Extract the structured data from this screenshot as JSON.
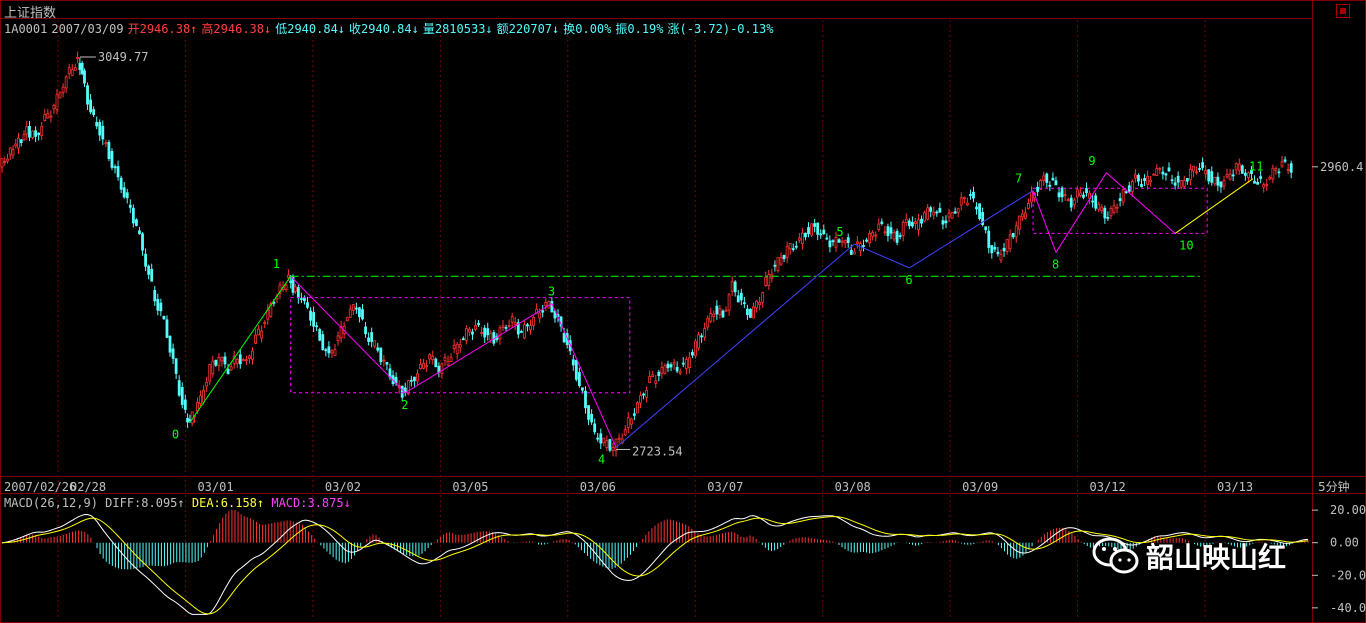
{
  "header": {
    "title": "上证指数",
    "code": "1A0001",
    "date": "2007/03/09",
    "open": "开2946.38↑",
    "high": "高2946.38↓",
    "low": "低2940.84↓",
    "close": "收2940.84↓",
    "volume": "量2810533↓",
    "amount": "额220707↓",
    "turnover": "换0.00%",
    "amplitude": "振0.19%",
    "change": "涨(-3.72)-0.13%"
  },
  "macd_header": {
    "label": "MACD(26,12,9)",
    "diff": "DIFF:8.095↑",
    "dea": "DEA:6.158↑",
    "macd": "MACD:3.875↓"
  },
  "period_label": "5分钟",
  "watermark": "韶山映山红",
  "colors": {
    "up": "#ff3232",
    "down": "#54fcfc",
    "grid": "#800000",
    "fib_line": "#ff00ff",
    "green": "#00ff00",
    "blue": "#4040ff",
    "yellow": "#ffff00"
  },
  "chart_data": {
    "type": "line",
    "x_labels": [
      "2007/02/26",
      "02/28",
      "03/01",
      "03/02",
      "03/05",
      "03/06",
      "03/07",
      "03/08",
      "03/09",
      "03/12",
      "03/13"
    ],
    "price_labels": {
      "high": "3049.77",
      "low": "2723.54",
      "last": "2960.4"
    },
    "ylim": [
      2700,
      3070
    ],
    "price_path": [
      [
        0,
        2960
      ],
      [
        3,
        2975
      ],
      [
        6,
        2990
      ],
      [
        8,
        2985
      ],
      [
        10,
        3000
      ],
      [
        12,
        3010
      ],
      [
        14,
        3030
      ],
      [
        16,
        3045
      ],
      [
        17,
        3049
      ],
      [
        18,
        3040
      ],
      [
        20,
        3005
      ],
      [
        22,
        2990
      ],
      [
        24,
        2970
      ],
      [
        26,
        2950
      ],
      [
        28,
        2930
      ],
      [
        30,
        2910
      ],
      [
        32,
        2880
      ],
      [
        34,
        2850
      ],
      [
        36,
        2830
      ],
      [
        38,
        2795
      ],
      [
        40,
        2760
      ],
      [
        41,
        2745
      ],
      [
        42,
        2750
      ],
      [
        44,
        2765
      ],
      [
        46,
        2790
      ],
      [
        48,
        2800
      ],
      [
        50,
        2790
      ],
      [
        52,
        2800
      ],
      [
        54,
        2795
      ],
      [
        56,
        2815
      ],
      [
        58,
        2830
      ],
      [
        60,
        2850
      ],
      [
        62,
        2860
      ],
      [
        63,
        2868
      ],
      [
        64,
        2858
      ],
      [
        66,
        2850
      ],
      [
        68,
        2835
      ],
      [
        70,
        2815
      ],
      [
        72,
        2800
      ],
      [
        74,
        2815
      ],
      [
        76,
        2835
      ],
      [
        78,
        2845
      ],
      [
        80,
        2820
      ],
      [
        82,
        2810
      ],
      [
        84,
        2795
      ],
      [
        86,
        2780
      ],
      [
        88,
        2770
      ],
      [
        90,
        2780
      ],
      [
        92,
        2790
      ],
      [
        94,
        2800
      ],
      [
        96,
        2790
      ],
      [
        98,
        2800
      ],
      [
        100,
        2810
      ],
      [
        102,
        2820
      ],
      [
        104,
        2825
      ],
      [
        106,
        2820
      ],
      [
        108,
        2815
      ],
      [
        110,
        2825
      ],
      [
        112,
        2830
      ],
      [
        114,
        2820
      ],
      [
        116,
        2830
      ],
      [
        118,
        2840
      ],
      [
        120,
        2845
      ],
      [
        122,
        2830
      ],
      [
        124,
        2810
      ],
      [
        126,
        2785
      ],
      [
        128,
        2760
      ],
      [
        130,
        2735
      ],
      [
        132,
        2728
      ],
      [
        134,
        2724
      ],
      [
        136,
        2735
      ],
      [
        138,
        2750
      ],
      [
        140,
        2765
      ],
      [
        142,
        2780
      ],
      [
        144,
        2785
      ],
      [
        146,
        2795
      ],
      [
        148,
        2790
      ],
      [
        150,
        2795
      ],
      [
        152,
        2810
      ],
      [
        154,
        2825
      ],
      [
        156,
        2840
      ],
      [
        158,
        2835
      ],
      [
        160,
        2860
      ],
      [
        162,
        2845
      ],
      [
        164,
        2835
      ],
      [
        166,
        2850
      ],
      [
        168,
        2870
      ],
      [
        170,
        2880
      ],
      [
        172,
        2890
      ],
      [
        174,
        2895
      ],
      [
        176,
        2905
      ],
      [
        178,
        2910
      ],
      [
        180,
        2900
      ],
      [
        182,
        2895
      ],
      [
        184,
        2900
      ],
      [
        186,
        2890
      ],
      [
        188,
        2895
      ],
      [
        190,
        2900
      ],
      [
        192,
        2910
      ],
      [
        194,
        2905
      ],
      [
        196,
        2900
      ],
      [
        198,
        2915
      ],
      [
        200,
        2910
      ],
      [
        202,
        2920
      ],
      [
        204,
        2925
      ],
      [
        206,
        2915
      ],
      [
        208,
        2920
      ],
      [
        210,
        2930
      ],
      [
        212,
        2935
      ],
      [
        214,
        2920
      ],
      [
        216,
        2895
      ],
      [
        218,
        2885
      ],
      [
        220,
        2895
      ],
      [
        222,
        2910
      ],
      [
        224,
        2925
      ],
      [
        226,
        2940
      ],
      [
        228,
        2950
      ],
      [
        230,
        2945
      ],
      [
        232,
        2935
      ],
      [
        234,
        2930
      ],
      [
        236,
        2940
      ],
      [
        238,
        2935
      ],
      [
        240,
        2925
      ],
      [
        242,
        2918
      ],
      [
        244,
        2930
      ],
      [
        246,
        2940
      ],
      [
        248,
        2950
      ],
      [
        250,
        2945
      ],
      [
        252,
        2955
      ],
      [
        254,
        2958
      ],
      [
        256,
        2950
      ],
      [
        258,
        2945
      ],
      [
        260,
        2955
      ],
      [
        262,
        2960
      ],
      [
        264,
        2952
      ],
      [
        266,
        2945
      ],
      [
        268,
        2950
      ],
      [
        270,
        2960
      ],
      [
        272,
        2955
      ],
      [
        274,
        2950
      ],
      [
        276,
        2945
      ],
      [
        278,
        2955
      ],
      [
        280,
        2962
      ],
      [
        282,
        2958
      ]
    ],
    "wave_points": [
      {
        "label": "0",
        "t": 41,
        "p": 2745,
        "lpos": "below-left"
      },
      {
        "label": "1",
        "t": 63,
        "p": 2868,
        "lpos": "above-left"
      },
      {
        "label": "2",
        "t": 88,
        "p": 2770,
        "lpos": "below"
      },
      {
        "label": "3",
        "t": 120,
        "p": 2845,
        "lpos": "above"
      },
      {
        "label": "4",
        "t": 134,
        "p": 2724,
        "lpos": "below-left"
      },
      {
        "label": "5",
        "t": 186,
        "p": 2895,
        "lpos": "above-left"
      },
      {
        "label": "6",
        "t": 198,
        "p": 2875,
        "lpos": "below"
      },
      {
        "label": "7",
        "t": 225,
        "p": 2940,
        "lpos": "above-left"
      },
      {
        "label": "8",
        "t": 230,
        "p": 2888,
        "lpos": "below"
      },
      {
        "label": "9",
        "t": 241,
        "p": 2955,
        "lpos": "above-left"
      },
      {
        "label": "10",
        "t": 256,
        "p": 2904,
        "lpos": "below-right"
      },
      {
        "label": "11",
        "t": 273,
        "p": 2950,
        "lpos": "above"
      }
    ],
    "macd_ylim": [
      -45,
      25
    ],
    "macd_ticks": [
      "20.00",
      "0.00",
      "-20.00",
      "-40.00"
    ]
  }
}
